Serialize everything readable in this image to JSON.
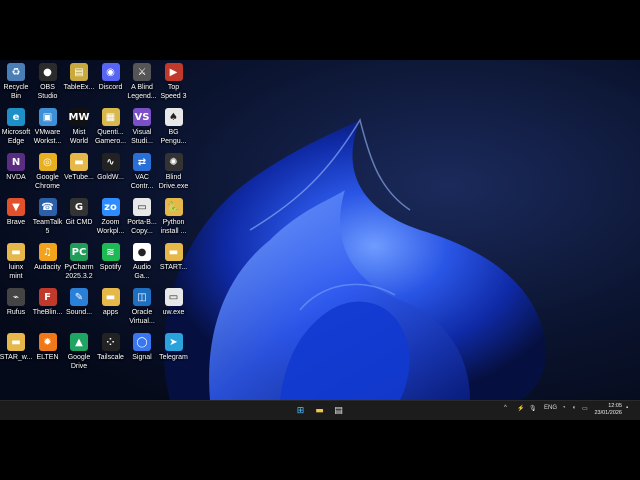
{
  "desktop": {
    "icons": [
      {
        "label": "Recycle\nBin",
        "icon": "recycle-bin-icon",
        "bg": "#4a7fb5",
        "glyph": "♻"
      },
      {
        "label": "OBS\nStudio",
        "icon": "obs-icon",
        "bg": "#2b2b2b",
        "glyph": "●"
      },
      {
        "label": "TableEx...",
        "icon": "tableex-icon",
        "bg": "#c9a93d",
        "glyph": "▤"
      },
      {
        "label": "Discord",
        "icon": "discord-icon",
        "bg": "#5865f2",
        "glyph": "◉"
      },
      {
        "label": "A Blind\nLegend...",
        "icon": "a-blind-legend-icon",
        "bg": "#555555",
        "glyph": "⚔"
      },
      {
        "label": "Top\nSpeed 3",
        "icon": "top-speed-icon",
        "bg": "#c0392b",
        "glyph": "▶"
      },
      {
        "label": "Microsoft\nEdge",
        "icon": "edge-icon",
        "bg": "#1e90c8",
        "glyph": "e"
      },
      {
        "label": "VMware\nWorkst...",
        "icon": "vmware-icon",
        "bg": "#3d8fd6",
        "glyph": "▣"
      },
      {
        "label": "Mist\nWorld",
        "icon": "mist-world-icon",
        "bg": "#111111",
        "glyph": "MW"
      },
      {
        "label": "Quenti...\nGamero...",
        "icon": "quentin-icon",
        "bg": "#d8b84a",
        "glyph": "▦"
      },
      {
        "label": "Visual\nStudi...",
        "icon": "visual-studio-icon",
        "bg": "#7b4fc7",
        "glyph": "VS"
      },
      {
        "label": "BG\nPengu...",
        "icon": "bg-penguin-icon",
        "bg": "#e8e8e8",
        "glyph": "♠"
      },
      {
        "label": "NVDA",
        "icon": "nvda-icon",
        "bg": "#5a2d82",
        "glyph": "N"
      },
      {
        "label": "Google\nChrome",
        "icon": "chrome-icon",
        "bg": "#e8b020",
        "glyph": "◎"
      },
      {
        "label": "VeTube...",
        "icon": "vetube-folder-icon",
        "bg": "#e6b84a",
        "glyph": "▬"
      },
      {
        "label": "GoldW...",
        "icon": "goldwave-icon",
        "bg": "#222222",
        "glyph": "∿"
      },
      {
        "label": "VAC\nContr...",
        "icon": "vac-control-icon",
        "bg": "#2a6fd6",
        "glyph": "⇄"
      },
      {
        "label": "Blind\nDrive.exe",
        "icon": "blind-drive-icon",
        "bg": "#333333",
        "glyph": "✺"
      },
      {
        "label": "Brave",
        "icon": "brave-icon",
        "bg": "#e2512b",
        "glyph": "▼"
      },
      {
        "label": "TeamTalk\n5",
        "icon": "teamtalk-icon",
        "bg": "#2b5fa8",
        "glyph": "☎"
      },
      {
        "label": "Git CMD",
        "icon": "git-cmd-icon",
        "bg": "#333333",
        "glyph": "G"
      },
      {
        "label": "Zoom\nWorkpl...",
        "icon": "zoom-icon",
        "bg": "#2d8cff",
        "glyph": "zo"
      },
      {
        "label": "Porta-B...\nCopy...",
        "icon": "porta-bot-icon",
        "bg": "#e8e8e8",
        "glyph": "▭"
      },
      {
        "label": "Python\ninstall ...",
        "icon": "python-install-icon",
        "bg": "#e6b84a",
        "glyph": "🐍"
      },
      {
        "label": "luinx\nmint",
        "icon": "linux-mint-folder-icon",
        "bg": "#e6b84a",
        "glyph": "▬"
      },
      {
        "label": "Audacity",
        "icon": "audacity-icon",
        "bg": "#f2a31b",
        "glyph": "♫"
      },
      {
        "label": "PyCharm\n2025.3.2",
        "icon": "pycharm-icon",
        "bg": "#1f9e5a",
        "glyph": "PC"
      },
      {
        "label": "Spotify",
        "icon": "spotify-icon",
        "bg": "#1db954",
        "glyph": "≋"
      },
      {
        "label": "Audio\nGa...",
        "icon": "audio-game-icon",
        "bg": "#ffffff",
        "glyph": "●"
      },
      {
        "label": "START...",
        "icon": "start-folder-icon",
        "bg": "#e6b84a",
        "glyph": "▬"
      },
      {
        "label": "Rufus",
        "icon": "rufus-icon",
        "bg": "#444444",
        "glyph": "⌁"
      },
      {
        "label": "TheBlin...",
        "icon": "the-blind-icon",
        "bg": "#c0392b",
        "glyph": "F"
      },
      {
        "label": "Sound...",
        "icon": "sound-icon",
        "bg": "#2a7fd6",
        "glyph": "✎"
      },
      {
        "label": "apps",
        "icon": "apps-folder-icon",
        "bg": "#e6b84a",
        "glyph": "▬"
      },
      {
        "label": "Oracle\nVirtual...",
        "icon": "virtualbox-icon",
        "bg": "#1f6fc0",
        "glyph": "◫"
      },
      {
        "label": "uw.exe",
        "icon": "uw-exe-icon",
        "bg": "#e8e8e8",
        "glyph": "▭"
      },
      {
        "label": "STAR_w...",
        "icon": "star-folder-icon",
        "bg": "#e6b84a",
        "glyph": "▬"
      },
      {
        "label": "ELTEN",
        "icon": "elten-icon",
        "bg": "#f07818",
        "glyph": "✹"
      },
      {
        "label": "Google\nDrive",
        "icon": "google-drive-icon",
        "bg": "#1fa463",
        "glyph": "▲"
      },
      {
        "label": "Tailscale",
        "icon": "tailscale-icon",
        "bg": "#222222",
        "glyph": "⁘"
      },
      {
        "label": "Signal",
        "icon": "signal-icon",
        "bg": "#3a76f0",
        "glyph": "◯"
      },
      {
        "label": "Telegram",
        "icon": "telegram-icon",
        "bg": "#2aa3dc",
        "glyph": "➤"
      }
    ]
  },
  "taskbar": {
    "apps": [
      {
        "name": "start-button",
        "glyph": "⊞",
        "color": "#4cc2ff"
      },
      {
        "name": "file-explorer-button",
        "glyph": "▬",
        "color": "#f2c14e"
      },
      {
        "name": "pinned-app-button",
        "glyph": "▤",
        "color": "#e8e8e8"
      }
    ],
    "tray": {
      "chevron": "^",
      "language": "ENG",
      "time": "12:05",
      "date": "23/01/2026"
    }
  }
}
